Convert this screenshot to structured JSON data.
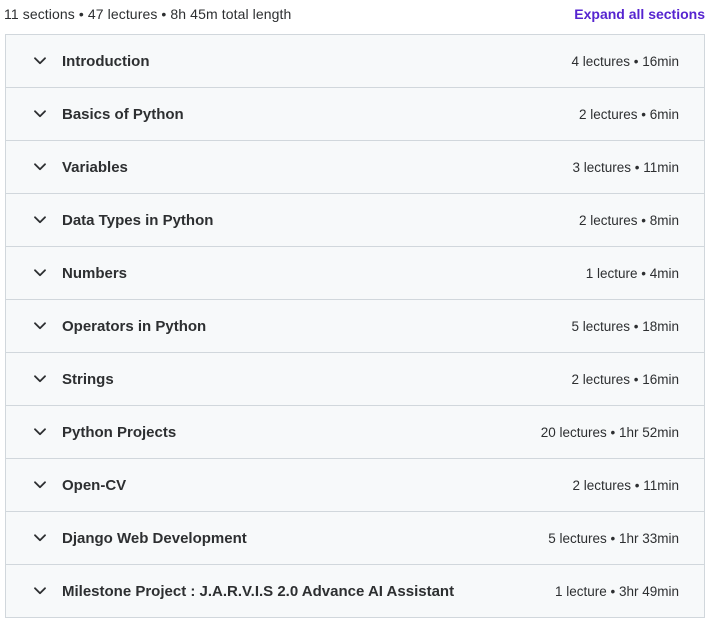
{
  "header": {
    "summary": "11 sections • 47 lectures • 8h 45m total length",
    "expand_label": "Expand all sections"
  },
  "sections": [
    {
      "title": "Introduction",
      "meta": "4 lectures • 16min"
    },
    {
      "title": "Basics of Python",
      "meta": "2 lectures • 6min"
    },
    {
      "title": "Variables",
      "meta": "3 lectures • 11min"
    },
    {
      "title": "Data Types in Python",
      "meta": "2 lectures • 8min"
    },
    {
      "title": "Numbers",
      "meta": "1 lecture • 4min"
    },
    {
      "title": "Operators in Python",
      "meta": "5 lectures • 18min"
    },
    {
      "title": "Strings",
      "meta": "2 lectures • 16min"
    },
    {
      "title": "Python Projects",
      "meta": "20 lectures • 1hr 52min"
    },
    {
      "title": "Open-CV",
      "meta": "2 lectures • 11min"
    },
    {
      "title": "Django Web Development",
      "meta": "5 lectures • 1hr 33min"
    },
    {
      "title": "Milestone Project : J.A.R.V.I.S 2.0 Advance AI Assistant",
      "meta": "1 lecture • 3hr 49min"
    }
  ],
  "icons": {
    "section_toggle": "chevron-down-icon"
  },
  "colors": {
    "accent": "#5624d0",
    "section_bg": "#f7f9fa",
    "border": "#d1d7dc",
    "text": "#2d2f31"
  }
}
